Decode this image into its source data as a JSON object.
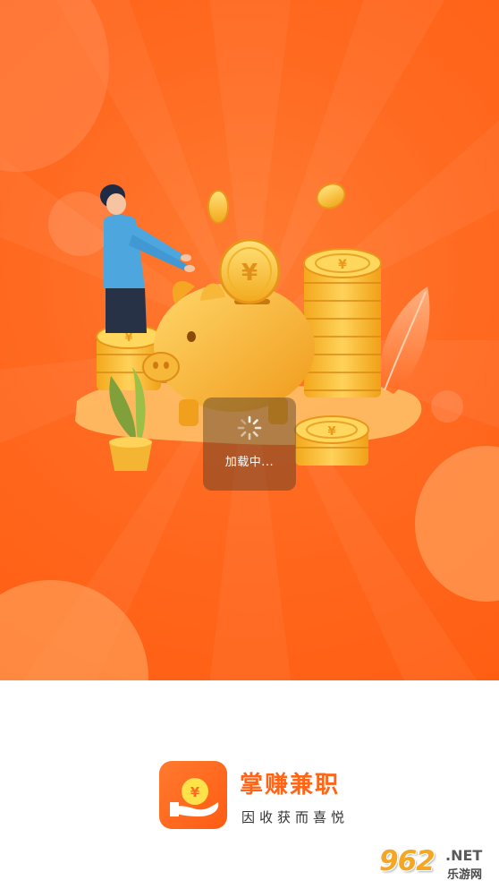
{
  "loading": {
    "text": "加载中..."
  },
  "brand": {
    "app_name": "掌赚兼职",
    "slogan": "因收获而喜悦",
    "icon_symbol": "¥"
  },
  "illustration": {
    "coin_symbol": "¥"
  },
  "watermark": {
    "number": "962",
    "suffix": ".NET",
    "site_name": "乐游网"
  },
  "colors": {
    "background_orange": "#ff6a21",
    "brand_orange": "#ff6417",
    "coin_gold": "#f7c531",
    "pig_gold": "#f4b128",
    "shirt_blue": "#4ea6de",
    "white": "#ffffff"
  }
}
